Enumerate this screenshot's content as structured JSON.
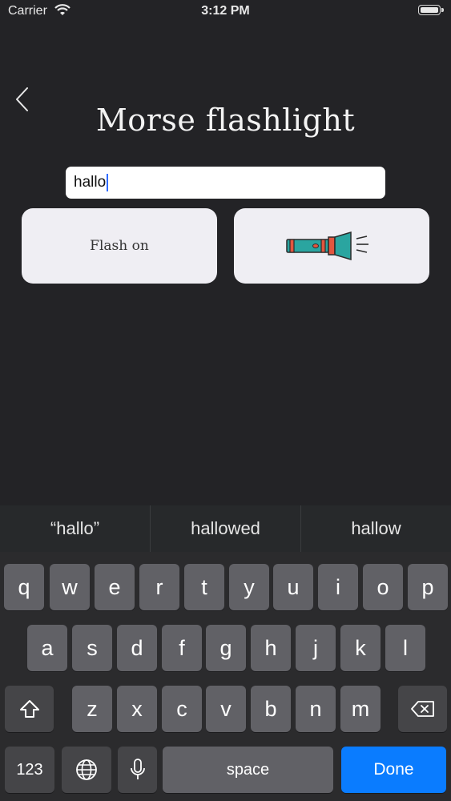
{
  "status_bar": {
    "carrier": "Carrier",
    "time": "3:12 PM"
  },
  "title": "Morse flashlight",
  "input": {
    "value": "hallo"
  },
  "buttons": {
    "flash_on": "Flash on"
  },
  "suggestions": [
    "“hallo”",
    "hallowed",
    "hallow"
  ],
  "keyboard": {
    "row1": [
      "q",
      "w",
      "e",
      "r",
      "t",
      "y",
      "u",
      "i",
      "o",
      "p"
    ],
    "row2": [
      "a",
      "s",
      "d",
      "f",
      "g",
      "h",
      "j",
      "k",
      "l"
    ],
    "row3": [
      "z",
      "x",
      "c",
      "v",
      "b",
      "n",
      "m"
    ],
    "numbers_label": "123",
    "space_label": "space",
    "done_label": "Done"
  },
  "colors": {
    "background": "#232326",
    "accent": "#0a7cff",
    "flashlight_teal": "#2aa5a0",
    "flashlight_orange": "#e2563f"
  }
}
